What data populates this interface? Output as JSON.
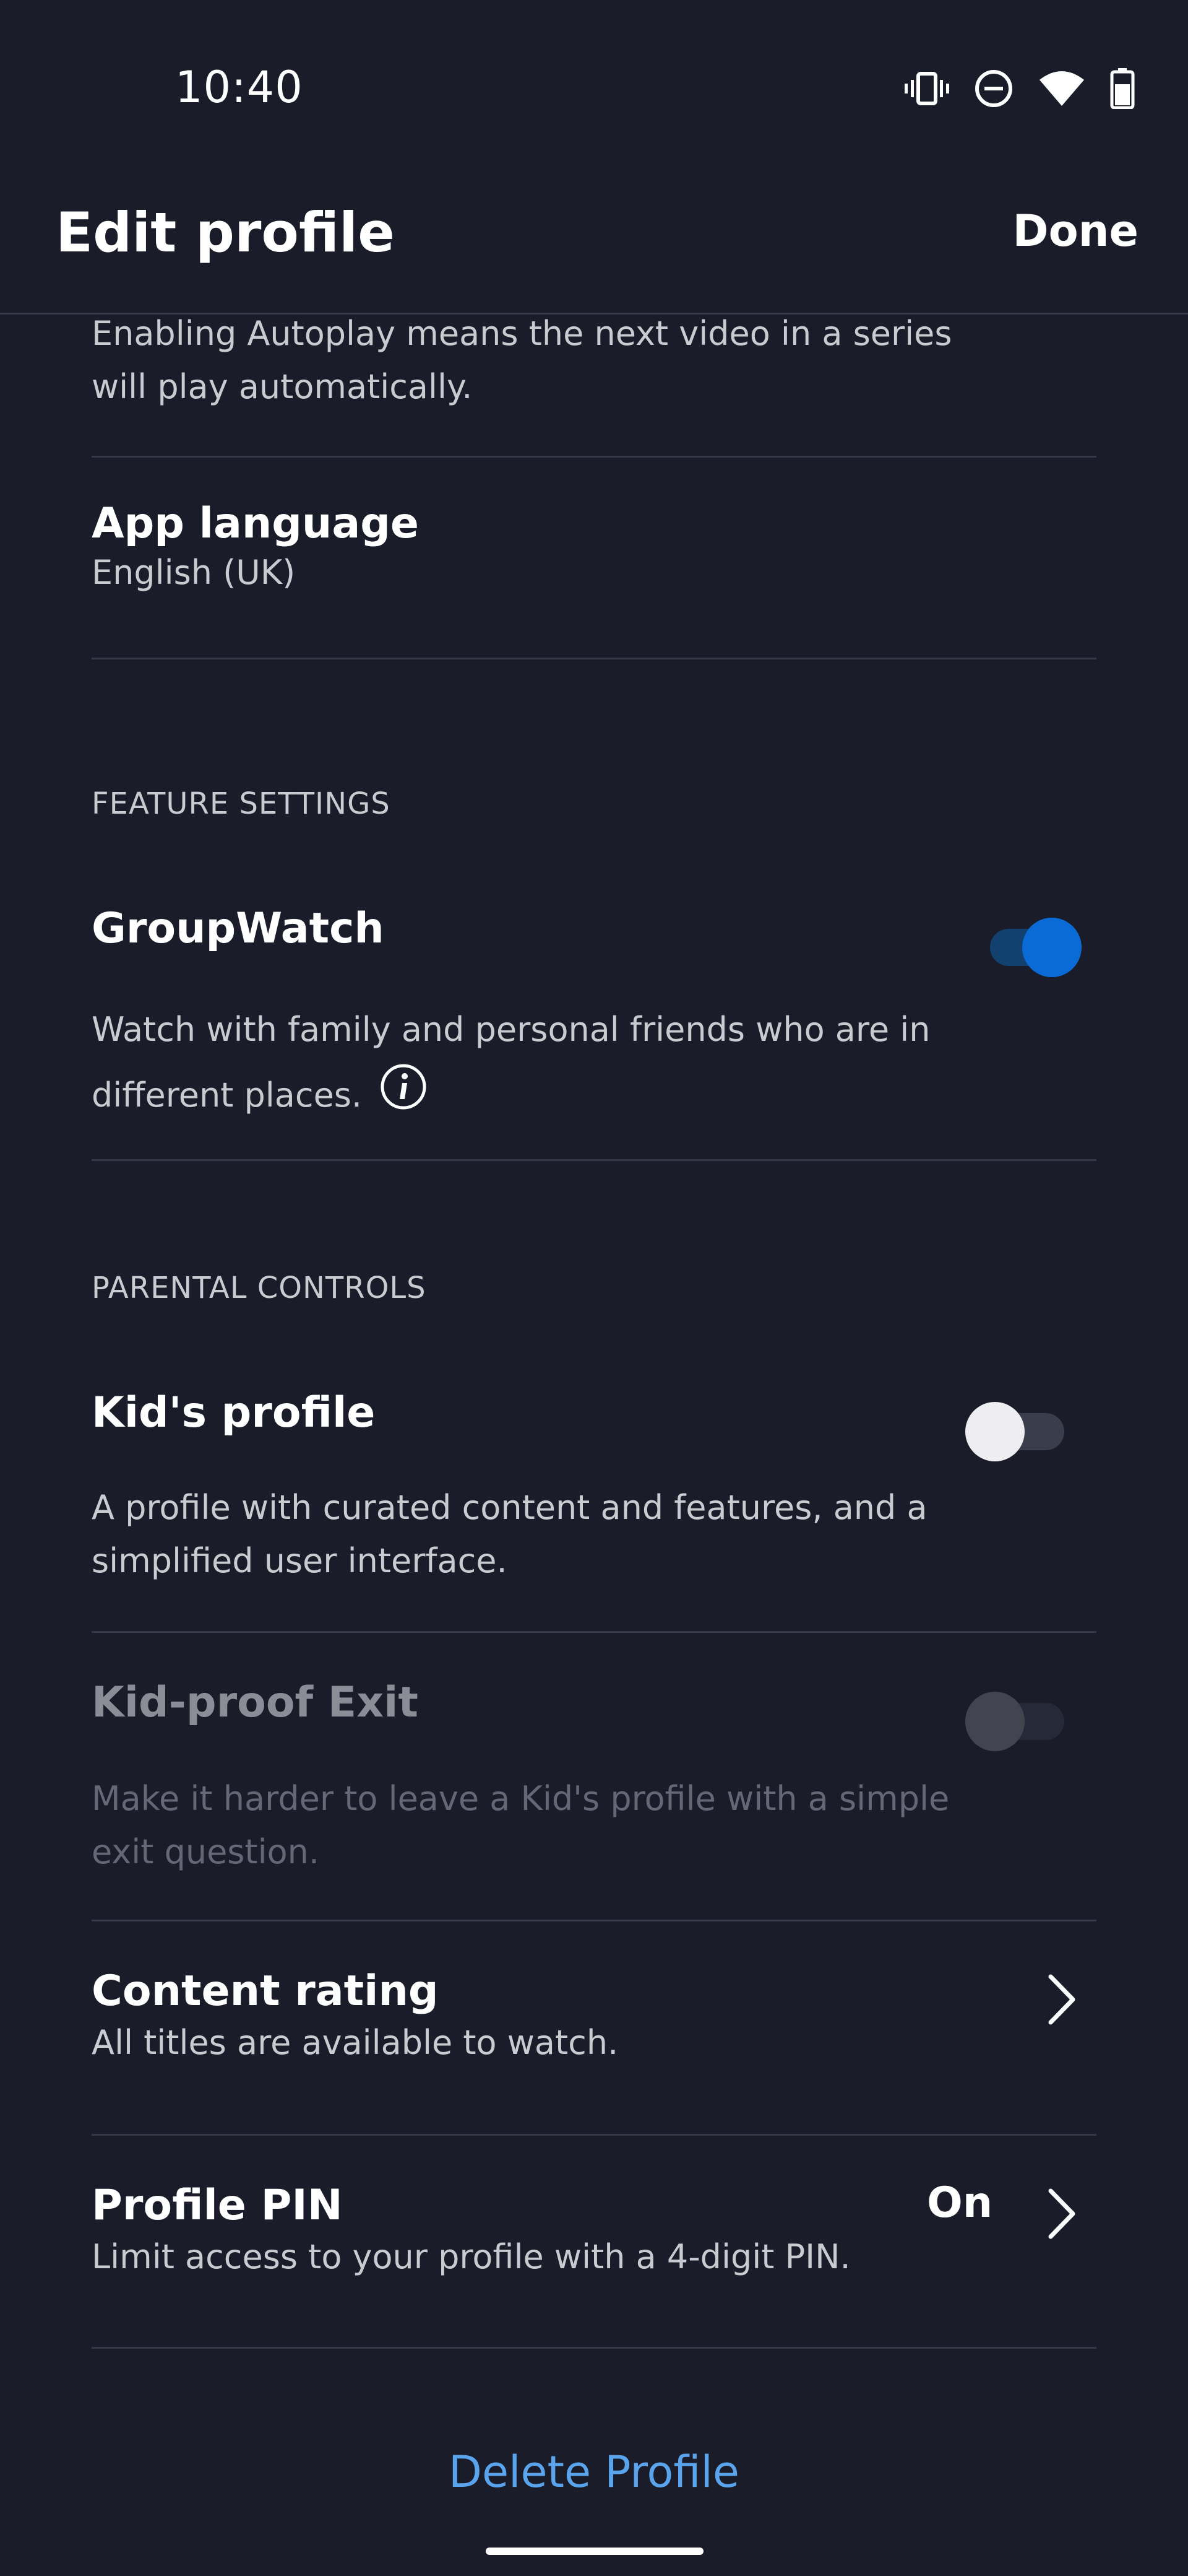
{
  "status_bar": {
    "time": "10:40",
    "icons": [
      "vibrate-icon",
      "do-not-disturb-icon",
      "wifi-icon",
      "battery-icon"
    ]
  },
  "header": {
    "title": "Edit profile",
    "done_label": "Done"
  },
  "autoplay": {
    "description": "Enabling Autoplay means the next video in a series will play automatically."
  },
  "app_language": {
    "title": "App language",
    "value": "English (UK)"
  },
  "feature_settings": {
    "section_label": "FEATURE SETTINGS",
    "groupwatch": {
      "title": "GroupWatch",
      "description": "Watch with family and personal friends who are in different places.",
      "enabled": true,
      "info_icon": "info-icon"
    }
  },
  "parental_controls": {
    "section_label": "PARENTAL CONTROLS",
    "kids_profile": {
      "title": "Kid's profile",
      "description": "A profile with curated content and features, and a simplified user interface.",
      "enabled": false
    },
    "kid_proof_exit": {
      "title": "Kid-proof Exit",
      "description": "Make it harder to leave a Kid's profile with a simple exit question.",
      "enabled": false,
      "disabled": true
    },
    "content_rating": {
      "title": "Content rating",
      "description": "All titles are available to watch."
    },
    "profile_pin": {
      "title": "Profile PIN",
      "value": "On",
      "description": "Limit access to your profile with a 4-digit PIN."
    }
  },
  "delete_profile_label": "Delete Profile",
  "colors": {
    "background": "#1a1d29",
    "accent": "#0063e5",
    "link": "#5aa4ee",
    "divider": "#343748"
  }
}
